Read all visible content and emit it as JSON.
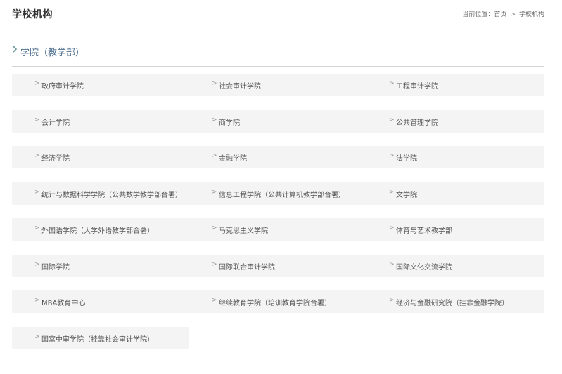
{
  "header": {
    "title": "学校机构",
    "breadcrumb": {
      "prefix": "当前位置：",
      "home": "首页",
      "separator": ">",
      "current": "学校机构"
    }
  },
  "section": {
    "title": "学院（教学部）",
    "accent_color": "#4f6f8f",
    "chevron_color": "#6a9a9a"
  },
  "items": [
    "政府审计学院",
    "社会审计学院",
    "工程审计学院",
    "会计学院",
    "商学院",
    "公共管理学院",
    "经济学院",
    "金融学院",
    "法学院",
    "统计与数据科学学院（公共数学教学部合署）",
    "信息工程学院（公共计算机教学部合署）",
    "文学院",
    "外国语学院（大学外语教学部合署）",
    "马克思主义学院",
    "体育与艺术教学部",
    "国际学院",
    "国际联合审计学院",
    "国际文化交流学院",
    "MBA教育中心",
    "继续教育学院（培训教育学院合署）",
    "经济与金融研究院（挂靠金融学院）",
    "国富中审学院（挂靠社会审计学院）"
  ],
  "item_arrow": ">",
  "icons": {
    "section": "chevron-right-icon",
    "item": "chevron-right-icon"
  }
}
